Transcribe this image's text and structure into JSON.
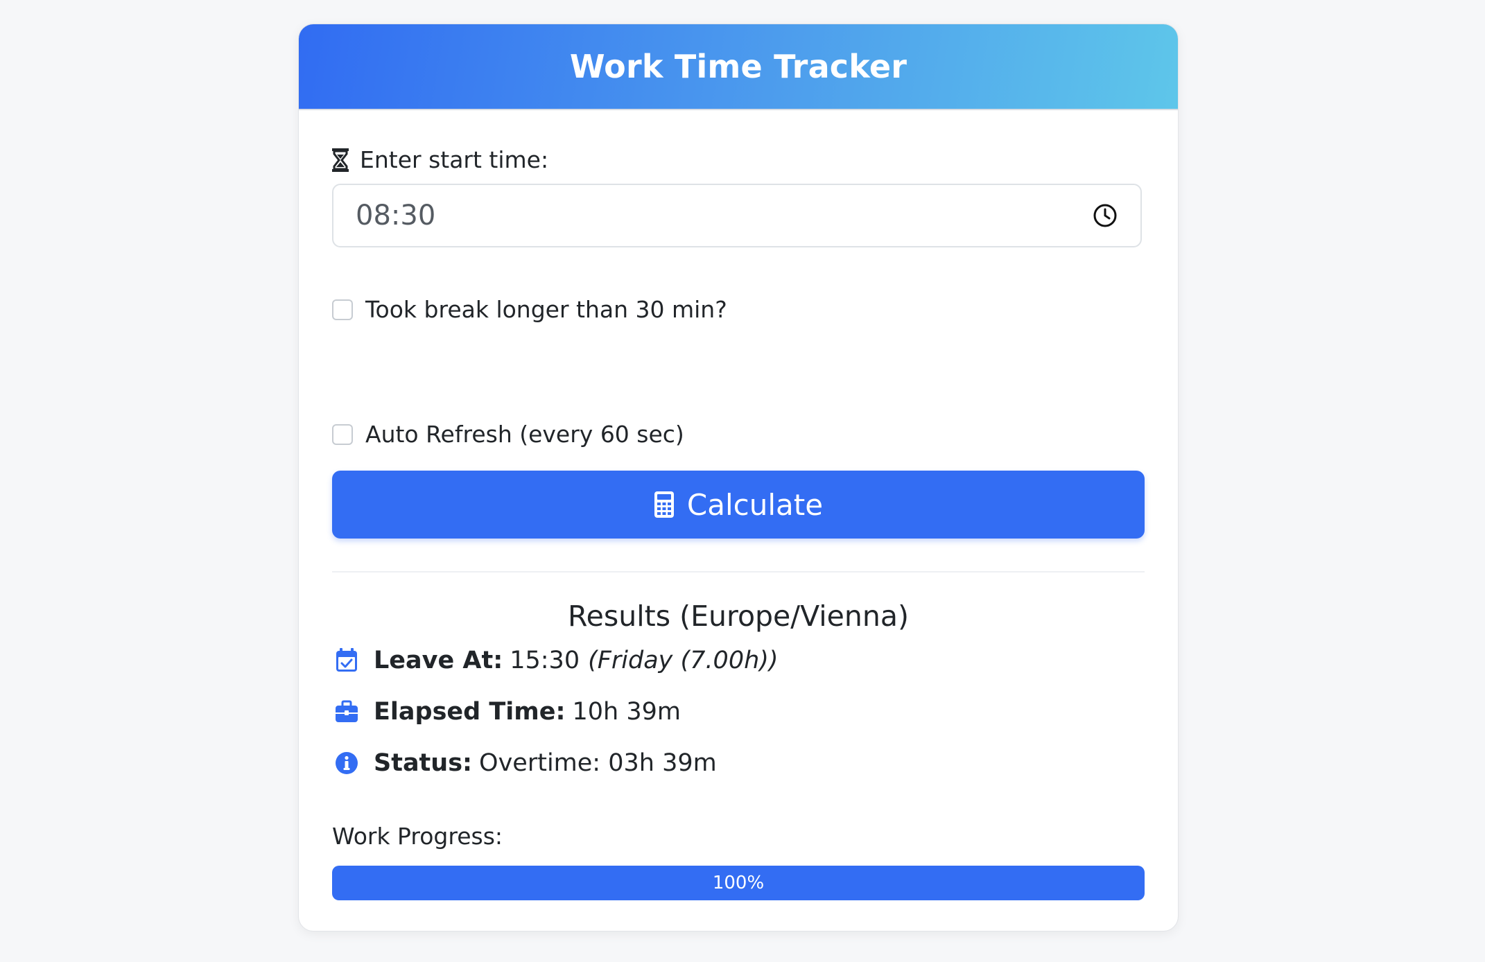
{
  "header": {
    "title": "Work Time Tracker"
  },
  "start_time": {
    "label": "Enter start time:",
    "value": "08:30",
    "icon": "hourglass-icon",
    "input_icon": "clock-icon"
  },
  "options": {
    "long_break_label": "Took break longer than 30 min?",
    "long_break_checked": false,
    "auto_refresh_label": "Auto Refresh (every 60 sec)",
    "auto_refresh_checked": false
  },
  "calculate_button": {
    "label": "Calculate",
    "icon": "calculator-icon"
  },
  "results": {
    "title": "Results (Europe/Vienna)",
    "leave_at": {
      "icon": "calendar-check-icon",
      "label": "Leave At:",
      "value": "15:30",
      "note": "(Friday (7.00h))"
    },
    "elapsed": {
      "icon": "briefcase-icon",
      "label": "Elapsed Time:",
      "value": "10h 39m"
    },
    "status": {
      "icon": "info-icon",
      "label": "Status:",
      "value": "Overtime: 03h 39m"
    }
  },
  "progress": {
    "label": "Work Progress:",
    "percent": 100,
    "percent_text": "100%"
  },
  "colors": {
    "accent": "#336df3",
    "header_gradient_start": "#316cf2",
    "header_gradient_end": "#5ec6ea",
    "background": "#f6f7f9"
  }
}
